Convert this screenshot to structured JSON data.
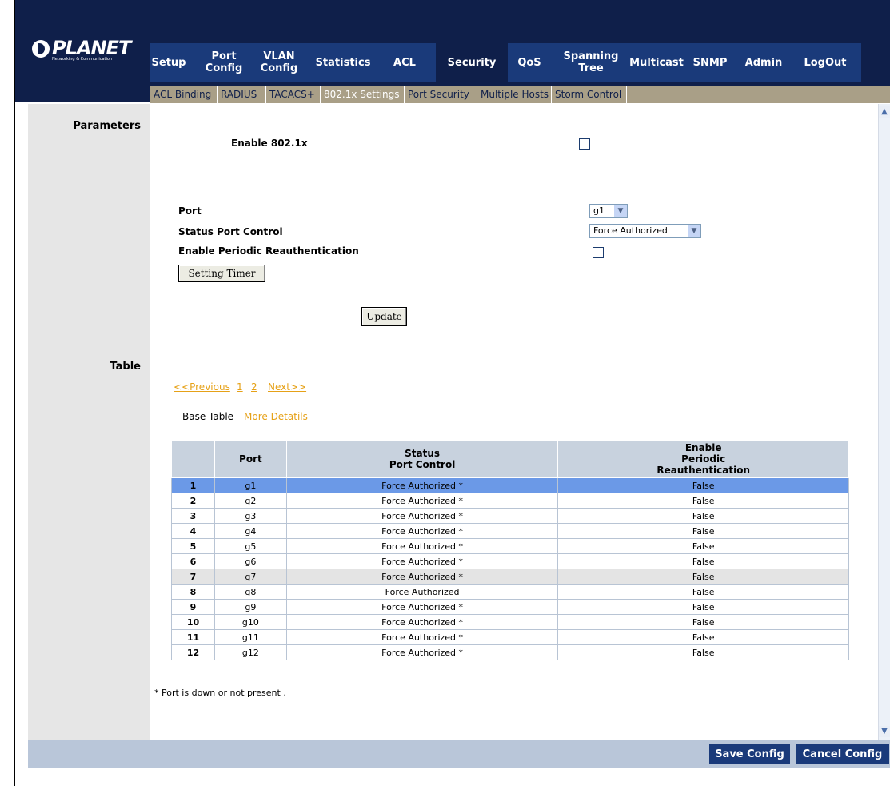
{
  "brand": {
    "name": "PLANET",
    "tagline": "Networking & Communication"
  },
  "nav": {
    "items": [
      {
        "label": "Setup"
      },
      {
        "label": "Port Config"
      },
      {
        "label": "VLAN Config"
      },
      {
        "label": "Statistics"
      },
      {
        "label": "ACL"
      },
      {
        "label": "Security"
      },
      {
        "label": "QoS"
      },
      {
        "label": "Spanning Tree"
      },
      {
        "label": "Multicast"
      },
      {
        "label": "SNMP"
      },
      {
        "label": "Admin"
      },
      {
        "label": "LogOut"
      }
    ],
    "active": "Security"
  },
  "subnav": {
    "items": [
      {
        "label": "ACL Binding"
      },
      {
        "label": "RADIUS"
      },
      {
        "label": "TACACS+"
      },
      {
        "label": "802.1x Settings"
      },
      {
        "label": "Port Security"
      },
      {
        "label": "Multiple Hosts"
      },
      {
        "label": "Storm Control"
      }
    ],
    "active": "802.1x Settings"
  },
  "sections": {
    "parameters": "Parameters",
    "table": "Table"
  },
  "form": {
    "enable_label": "Enable 802.1x",
    "enable_checked": false,
    "port_label": "Port",
    "port_value": "g1",
    "status_label": "Status Port Control",
    "status_value": "Force Authorized",
    "periodic_label": "Enable Periodic Reauthentication",
    "periodic_checked": false,
    "setting_timer_btn": "Setting Timer",
    "update_btn": "Update"
  },
  "pager": {
    "prev": "<<Previous",
    "pages": [
      "1",
      "2"
    ],
    "next": "Next>>"
  },
  "views": {
    "base": "Base Table",
    "more": "More Detatils"
  },
  "table": {
    "headers": {
      "port": "Port",
      "status_line1": "Status",
      "status_line2": "Port Control",
      "enable_line1": "Enable",
      "enable_line2": "Periodic",
      "enable_line3": "Reauthentication"
    },
    "rows": [
      {
        "idx": "1",
        "port": "g1",
        "status": "Force Authorized *",
        "periodic": "False"
      },
      {
        "idx": "2",
        "port": "g2",
        "status": "Force Authorized *",
        "periodic": "False"
      },
      {
        "idx": "3",
        "port": "g3",
        "status": "Force Authorized *",
        "periodic": "False"
      },
      {
        "idx": "4",
        "port": "g4",
        "status": "Force Authorized *",
        "periodic": "False"
      },
      {
        "idx": "5",
        "port": "g5",
        "status": "Force Authorized *",
        "periodic": "False"
      },
      {
        "idx": "6",
        "port": "g6",
        "status": "Force Authorized *",
        "periodic": "False"
      },
      {
        "idx": "7",
        "port": "g7",
        "status": "Force Authorized *",
        "periodic": "False"
      },
      {
        "idx": "8",
        "port": "g8",
        "status": "Force Authorized",
        "periodic": "False"
      },
      {
        "idx": "9",
        "port": "g9",
        "status": "Force Authorized *",
        "periodic": "False"
      },
      {
        "idx": "10",
        "port": "g10",
        "status": "Force Authorized *",
        "periodic": "False"
      },
      {
        "idx": "11",
        "port": "g11",
        "status": "Force Authorized *",
        "periodic": "False"
      },
      {
        "idx": "12",
        "port": "g12",
        "status": "Force Authorized *",
        "periodic": "False"
      }
    ],
    "selected_row": 1,
    "highlighted_row": 7
  },
  "footnote": "* Port is down or not present .",
  "actions": {
    "save": "Save Config",
    "cancel": "Cancel Config"
  },
  "colors": {
    "header_bg": "#0f1f4a",
    "nav_bg": "#1a3a7a",
    "subnav_bg": "#a99f87",
    "link": "#e6a117",
    "selected_row": "#6b99e7"
  }
}
